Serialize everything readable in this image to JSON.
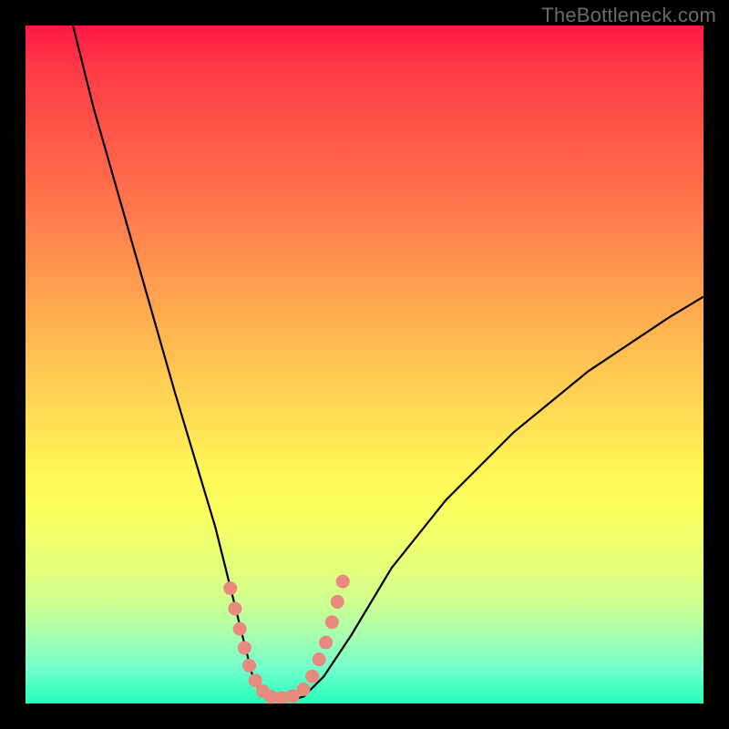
{
  "watermark": "TheBottleneck.com",
  "chart_data": {
    "type": "line",
    "title": "",
    "xlabel": "",
    "ylabel": "",
    "xlim": [
      0,
      100
    ],
    "ylim": [
      0,
      100
    ],
    "series": [
      {
        "name": "bottleneck-curve",
        "x": [
          7,
          10,
          14,
          18,
          22,
          25,
          28,
          30,
          32,
          33.5,
          35,
          37,
          39,
          41,
          44,
          48,
          54,
          62,
          72,
          83,
          95,
          100
        ],
        "y": [
          100,
          88,
          74,
          60,
          46,
          36,
          26,
          18,
          10,
          4,
          1,
          0.5,
          0.5,
          1,
          4,
          10,
          20,
          30,
          40,
          49,
          57,
          60
        ]
      }
    ],
    "highlight_dots": {
      "name": "threshold-markers",
      "points": [
        [
          30.2,
          17.0
        ],
        [
          30.9,
          14.0
        ],
        [
          31.6,
          11.0
        ],
        [
          32.3,
          8.2
        ],
        [
          33.0,
          5.6
        ],
        [
          33.9,
          3.4
        ],
        [
          35.0,
          1.8
        ],
        [
          36.2,
          1.0
        ],
        [
          37.8,
          0.8
        ],
        [
          39.4,
          1.1
        ],
        [
          41.0,
          2.1
        ],
        [
          42.3,
          4.0
        ],
        [
          43.3,
          6.5
        ],
        [
          44.3,
          9.0
        ],
        [
          45.2,
          12.0
        ],
        [
          46.0,
          15.0
        ],
        [
          46.8,
          18.0
        ]
      ]
    },
    "grid": false,
    "legend": false,
    "background": "rainbow-vertical-gradient"
  }
}
